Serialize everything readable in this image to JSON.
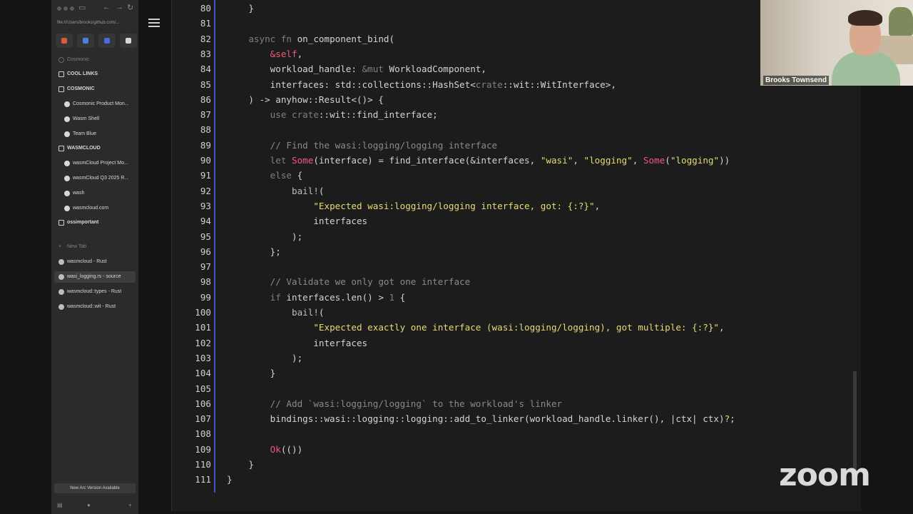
{
  "browser": {
    "url": "file:///Users/brooks/github.com/...",
    "favorites": [
      {
        "name": "gmail-icon",
        "color": "#e05a3a"
      },
      {
        "name": "calendar-icon",
        "color": "#4a7fe0"
      },
      {
        "name": "app-icon",
        "color": "#4a6ae0"
      },
      {
        "name": "github-icon",
        "color": "#d8d8d8"
      }
    ],
    "sidebar": [
      {
        "label": "Cosmonic",
        "type": "dim"
      },
      {
        "label": "COOL LINKS",
        "type": "folder"
      },
      {
        "label": "COSMONIC",
        "type": "folder"
      },
      {
        "label": "Cosmonic Product Mon...",
        "type": "child"
      },
      {
        "label": "Wasm Shell",
        "type": "child"
      },
      {
        "label": "Team Blue",
        "type": "child"
      },
      {
        "label": "WASMCLOUD",
        "type": "folder"
      },
      {
        "label": "wasmCloud Project Mo...",
        "type": "child"
      },
      {
        "label": "wasmCloud Q3 2025 R...",
        "type": "child"
      },
      {
        "label": "wash",
        "type": "child"
      },
      {
        "label": "wasmcloud.com",
        "type": "child"
      },
      {
        "label": "ossimportant",
        "type": "folder"
      },
      {
        "label": "New Tab",
        "type": "newtab"
      },
      {
        "label": "wasmcloud - Rust",
        "type": "tab"
      },
      {
        "label": "wasi_logging.rs - source",
        "type": "tab-active"
      },
      {
        "label": "wasmcloud::types - Rust",
        "type": "tab"
      },
      {
        "label": "wasmcloud::wit - Rust",
        "type": "tab"
      }
    ],
    "update_label": "New Arc Version Available"
  },
  "code": {
    "lines": [
      {
        "n": "80",
        "html": "    }"
      },
      {
        "n": "81",
        "html": ""
      },
      {
        "n": "82",
        "html": "    <span class=\"kw\">async fn</span> on_component_bind("
      },
      {
        "n": "83",
        "html": "        <span class=\"pink\">&amp;self</span>,"
      },
      {
        "n": "84",
        "html": "        workload_handle: <span class=\"kw\">&amp;mut</span> WorkloadComponent,"
      },
      {
        "n": "85",
        "html": "        interfaces: std::collections::HashSet&lt;<span class=\"kw\">crate</span>::wit::WitInterface&gt;,"
      },
      {
        "n": "86",
        "html": "    ) -&gt; anyhow::Result&lt;()&gt; {"
      },
      {
        "n": "87",
        "html": "        <span class=\"kw\">use crate</span>::wit::find_interface;"
      },
      {
        "n": "88",
        "html": ""
      },
      {
        "n": "89",
        "html": "        <span class=\"cmt\">// Find the wasi:logging/logging interface</span>"
      },
      {
        "n": "90",
        "html": "        <span class=\"kw\">let</span> <span class=\"pink\">Some</span>(interface) = find_interface(&amp;interfaces, <span class=\"str\">\"wasi\"</span>, <span class=\"str\">\"logging\"</span>, <span class=\"pink\">Some</span>(<span class=\"str\">\"logging\"</span>))"
      },
      {
        "n": "91",
        "html": "        <span class=\"kw\">else</span> {"
      },
      {
        "n": "92",
        "html": "            <span class=\"mac\">bail!</span>("
      },
      {
        "n": "93",
        "html": "                <span class=\"str\">\"Expected wasi:logging/logging interface, got: {:?}\"</span>,"
      },
      {
        "n": "94",
        "html": "                interfaces"
      },
      {
        "n": "95",
        "html": "            );"
      },
      {
        "n": "96",
        "html": "        };"
      },
      {
        "n": "97",
        "html": ""
      },
      {
        "n": "98",
        "html": "        <span class=\"cmt\">// Validate we only got one interface</span>"
      },
      {
        "n": "99",
        "html": "        <span class=\"kw\">if</span> interfaces.len() &gt; <span class=\"kw\">1</span> {"
      },
      {
        "n": "100",
        "html": "            <span class=\"mac\">bail!</span>("
      },
      {
        "n": "101",
        "html": "                <span class=\"str\">\"Expected exactly one interface (wasi:logging/logging), got multiple: {:?}\"</span>,"
      },
      {
        "n": "102",
        "html": "                interfaces"
      },
      {
        "n": "103",
        "html": "            );"
      },
      {
        "n": "104",
        "html": "        }"
      },
      {
        "n": "105",
        "html": ""
      },
      {
        "n": "106",
        "html": "        <span class=\"cmt\">// Add `wasi:logging/logging` to the workload's linker</span>"
      },
      {
        "n": "107",
        "html": "        bindings::wasi::logging::logging::add_to_linker(workload_handle.linker(), |ctx| ctx)<span class=\"str\">?</span>;"
      },
      {
        "n": "108",
        "html": ""
      },
      {
        "n": "109",
        "html": "        <span class=\"pink\">Ok</span>(())"
      },
      {
        "n": "110",
        "html": "    }"
      },
      {
        "n": "111",
        "html": "}"
      }
    ]
  },
  "video": {
    "participant_name": "Brooks Townsend"
  },
  "zoom_logo": "zoom"
}
